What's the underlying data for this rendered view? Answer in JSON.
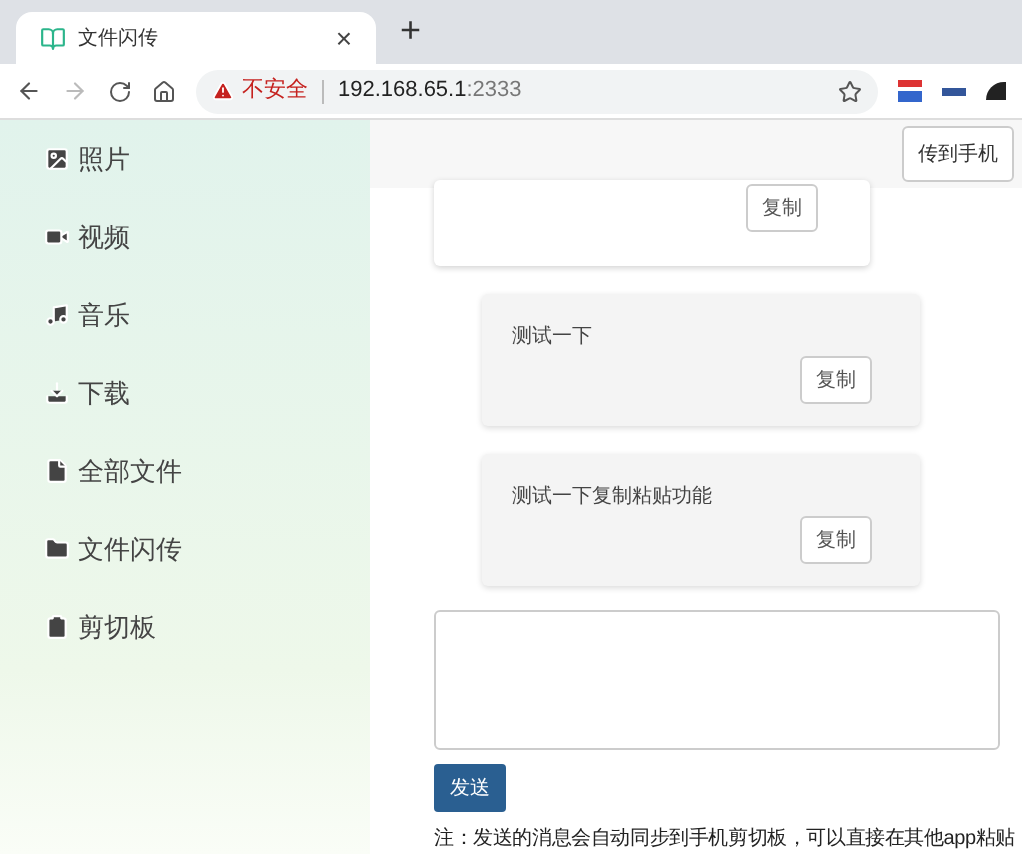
{
  "browser": {
    "tab_title": "文件闪传",
    "tab_close": "×",
    "new_tab": "+",
    "security": "不安全",
    "url_host": "192.168.65.1",
    "url_port": ":2333"
  },
  "sidebar": {
    "items": [
      {
        "label": "照片",
        "kind": "image"
      },
      {
        "label": "视频",
        "kind": "video"
      },
      {
        "label": "音乐",
        "kind": "music"
      },
      {
        "label": "下载",
        "kind": "download"
      },
      {
        "label": "全部文件",
        "kind": "file"
      },
      {
        "label": "文件闪传",
        "kind": "folder"
      },
      {
        "label": "剪切板",
        "kind": "clipboard"
      }
    ]
  },
  "header": {
    "button": "传到手机"
  },
  "messages": [
    {
      "kind": "sent",
      "copy_button": "复制"
    },
    {
      "kind": "received",
      "text": "测试一下",
      "copy_button": "复制"
    },
    {
      "kind": "received",
      "text": "测试一下复制粘贴功能",
      "copy_button": "复制"
    }
  ],
  "composer": {
    "send_button": "发送",
    "note": "注：发送的消息会自动同步到手机剪切板，可以直接在其他app粘贴"
  }
}
